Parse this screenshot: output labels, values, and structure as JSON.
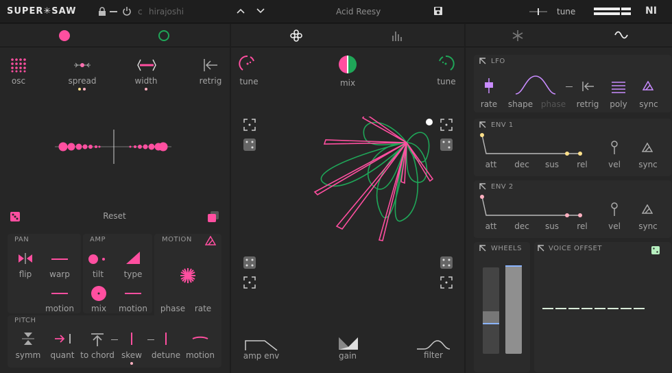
{
  "header": {
    "logo": "SUPER✳SAW",
    "key_note": "c",
    "scale": "hirajoshi",
    "preset": "Acid Reesy",
    "tune_label": "tune",
    "brand": "NI"
  },
  "left": {
    "osc": "osc",
    "spread": "spread",
    "width": "width",
    "retrig": "retrig",
    "reset": "Reset",
    "pan": {
      "title": "PAN",
      "flip": "flip",
      "warp": "warp",
      "motion": "motion"
    },
    "amp": {
      "title": "AMP",
      "tilt": "tilt",
      "type": "type",
      "mix": "mix",
      "motion": "motion"
    },
    "motion": {
      "title": "MOTION",
      "phase": "phase",
      "rate": "rate"
    },
    "pitch": {
      "title": "PITCH",
      "symm": "symm",
      "quant": "quant",
      "to_chord": "to chord",
      "skew": "skew",
      "detune": "detune",
      "motion": "motion"
    }
  },
  "center": {
    "tune_left": "tune",
    "mix": "mix",
    "tune_right": "tune",
    "amp_env": "amp env",
    "gain": "gain",
    "filter": "filter"
  },
  "right": {
    "lfo": {
      "title": "LFO",
      "rate": "rate",
      "shape": "shape",
      "phase": "phase",
      "retrig": "retrig",
      "poly": "poly",
      "sync": "sync"
    },
    "env1": {
      "title": "ENV 1",
      "att": "att",
      "dec": "dec",
      "sus": "sus",
      "rel": "rel",
      "vel": "vel",
      "sync": "sync"
    },
    "env2": {
      "title": "ENV 2",
      "att": "att",
      "dec": "dec",
      "sus": "sus",
      "rel": "rel",
      "vel": "vel",
      "sync": "sync"
    },
    "wheels": {
      "title": "WHEELS"
    },
    "voice_offset": {
      "title": "VOICE OFFSET"
    }
  },
  "colors": {
    "accent": "#ff4fa0",
    "green": "#1fa658",
    "lfo": "#c98cff",
    "env": "#ffe08a"
  }
}
